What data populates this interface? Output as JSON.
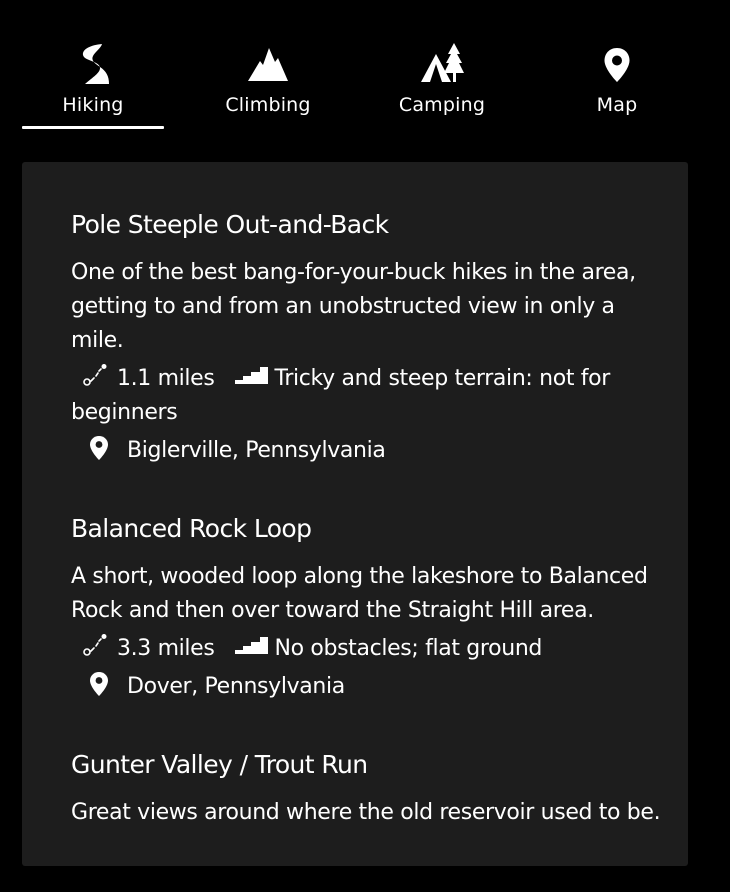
{
  "tabs": [
    {
      "label": "Hiking",
      "icon": "trail-icon",
      "active": true
    },
    {
      "label": "Climbing",
      "icon": "mountain-icon",
      "active": false
    },
    {
      "label": "Camping",
      "icon": "tent-icon",
      "active": false
    },
    {
      "label": "Map",
      "icon": "location-pin-icon",
      "active": false
    }
  ],
  "colors": {
    "background": "#000000",
    "card": "#1d1d1d",
    "text": "#ffffff"
  },
  "trails": [
    {
      "name": "Pole Steeple Out-and-Back",
      "description": "One of the best bang-for-your-buck hikes in the area, getting to and from an unobstructed view in only a mile.",
      "distance": "1.1 miles",
      "terrain": "Tricky and steep terrain: not for beginners",
      "location": "Biglerville, Pennsylvania"
    },
    {
      "name": "Balanced Rock Loop",
      "description": "A short, wooded loop along the lakeshore to Balanced Rock and then over toward the Straight Hill area.",
      "distance": "3.3 miles",
      "terrain": "No obstacles; flat ground",
      "location": "Dover, Pennsylvania"
    },
    {
      "name": "Gunter Valley / Trout Run",
      "description": "Great views around where the old reservoir used to be."
    }
  ]
}
